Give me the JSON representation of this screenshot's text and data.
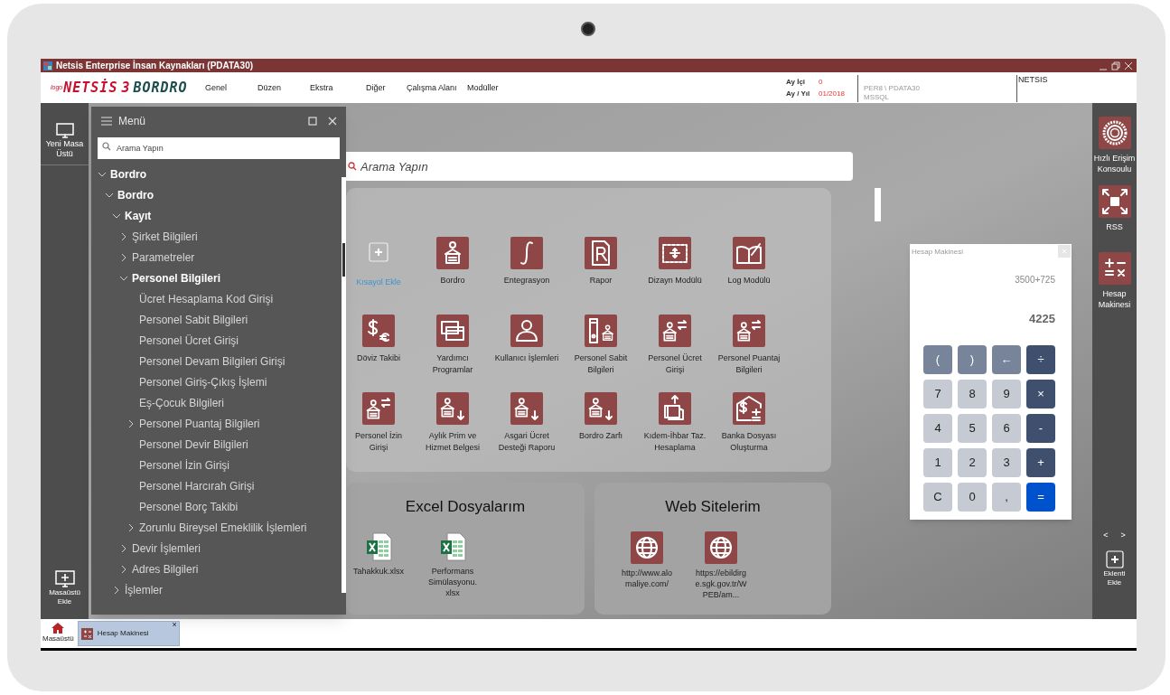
{
  "window": {
    "title": "Netsis Enterprise İnsan Kaynakları (PDATA30)"
  },
  "logo": {
    "prefix": "logo",
    "brand": "NETSİS",
    "version": "3",
    "product": "BORDRO"
  },
  "menu_bar": [
    "Genel",
    "Düzen",
    "Ekstra",
    "Diğer",
    "Çalışma Alanı",
    "Modüller"
  ],
  "status": {
    "period": [
      {
        "label": "Ay İçi",
        "value": "0"
      },
      {
        "label": "Ay / Yıl",
        "value": "01/2018"
      }
    ],
    "connection": [
      "PER8 \\ PDATA30",
      "MSSQL"
    ],
    "user": "NETSIS"
  },
  "left_sidebar": {
    "top": "Yeni Masa Üstü",
    "bottom": "Masaüstü Ekle"
  },
  "menu_panel": {
    "title": "Menü",
    "search": {
      "placeholder": "Arama Yapın"
    },
    "tree": [
      {
        "label": "Bordro",
        "kind": "group",
        "expanded": true,
        "children": [
          {
            "label": "Bordro",
            "kind": "group",
            "expanded": true,
            "children": [
              {
                "label": "Kayıt",
                "kind": "group",
                "expanded": true,
                "children": [
                  {
                    "label": "Şirket Bilgileri",
                    "kind": "group",
                    "expanded": false
                  },
                  {
                    "label": "Parametreler",
                    "kind": "group",
                    "expanded": false
                  },
                  {
                    "label": "Personel Bilgileri",
                    "kind": "group",
                    "expanded": true,
                    "children": [
                      {
                        "label": "Ücret Hesaplama Kod Girişi",
                        "kind": "leaf"
                      },
                      {
                        "label": "Personel Sabit Bilgileri",
                        "kind": "leaf"
                      },
                      {
                        "label": "Personel Ücret Girişi",
                        "kind": "leaf"
                      },
                      {
                        "label": "Personel Devam Bilgileri Girişi",
                        "kind": "leaf"
                      },
                      {
                        "label": "Personel Giriş-Çıkış İşlemi",
                        "kind": "leaf"
                      },
                      {
                        "label": "Eş-Çocuk Bilgileri",
                        "kind": "leaf"
                      },
                      {
                        "label": "Personel Puantaj Bilgileri",
                        "kind": "group",
                        "expanded": false
                      },
                      {
                        "label": "Personel Devir Bilgileri",
                        "kind": "leaf"
                      },
                      {
                        "label": "Personel İzin Girişi",
                        "kind": "leaf"
                      },
                      {
                        "label": "Personel Harcırah Girişi",
                        "kind": "leaf"
                      },
                      {
                        "label": "Personel Borç Takibi",
                        "kind": "leaf"
                      },
                      {
                        "label": "Zorunlu Bireysel Emeklilik İşlemleri",
                        "kind": "group",
                        "expanded": false
                      }
                    ]
                  },
                  {
                    "label": "Devir İşlemleri",
                    "kind": "group",
                    "expanded": false
                  },
                  {
                    "label": "Adres Bilgileri",
                    "kind": "group",
                    "expanded": false
                  }
                ]
              },
              {
                "label": "İşlemler",
                "kind": "group",
                "expanded": false
              }
            ]
          }
        ]
      }
    ]
  },
  "search": {
    "placeholder": "Arama Yapın"
  },
  "shortcuts": {
    "add_label": "Kısayol Ekle",
    "items": [
      "Bordro",
      "Entegrasyon",
      "Rapor",
      "Dizayn Modülü",
      "Log Modülü",
      "Döviz Takibi",
      "Yardımcı Programlar",
      "Kullanıcı İşlemleri",
      "Personel Sabit Bilgileri",
      "Personel Ücret Girişi",
      "Personel Puantaj Bilgileri",
      "Personel İzin Girişi",
      "Aylık Prim ve Hizmet Belgesi",
      "Asgari Ücret Desteği Raporu",
      "Bordro Zarfı",
      "Kıdem-İhbar Taz. Hesaplama",
      "Banka Dosyası Oluşturma"
    ]
  },
  "excel": {
    "title": "Excel Dosyalarım",
    "files": [
      "Tahakkuk.xlsx",
      "Performans Simülasyonu. xlsx"
    ]
  },
  "web": {
    "title": "Web Sitelerim",
    "sites": [
      "http://www.alomaliye.com/",
      "https://ebildirge.sgk.gov.tr/WPEB/am..."
    ]
  },
  "calculator": {
    "title": "Hesap Makinesi",
    "expression": "3500+725",
    "result": "4225",
    "keys": [
      {
        "label": "(",
        "kind": "paren"
      },
      {
        "label": ")",
        "kind": "paren"
      },
      {
        "label": "←",
        "kind": "paren"
      },
      {
        "label": "÷",
        "kind": "op"
      },
      {
        "label": "7",
        "kind": "digit"
      },
      {
        "label": "8",
        "kind": "digit"
      },
      {
        "label": "9",
        "kind": "digit"
      },
      {
        "label": "×",
        "kind": "op"
      },
      {
        "label": "4",
        "kind": "digit"
      },
      {
        "label": "5",
        "kind": "digit"
      },
      {
        "label": "6",
        "kind": "digit"
      },
      {
        "label": "-",
        "kind": "op"
      },
      {
        "label": "1",
        "kind": "digit"
      },
      {
        "label": "2",
        "kind": "digit"
      },
      {
        "label": "3",
        "kind": "digit"
      },
      {
        "label": "+",
        "kind": "op"
      },
      {
        "label": "C",
        "kind": "digit"
      },
      {
        "label": "0",
        "kind": "digit"
      },
      {
        "label": ",",
        "kind": "digit"
      },
      {
        "label": "=",
        "kind": "equals"
      }
    ]
  },
  "right_sidebar": {
    "items": [
      "Hızlı Erişim Konsoulu",
      "RSS",
      "Hesap Makinesi"
    ],
    "nav": [
      "<",
      ">"
    ],
    "add": "Eklenti Ekle"
  },
  "taskbar": [
    {
      "label": "Masaüstü",
      "selected": false
    },
    {
      "label": "Hesap Makinesi",
      "selected": true,
      "close": "×"
    }
  ]
}
